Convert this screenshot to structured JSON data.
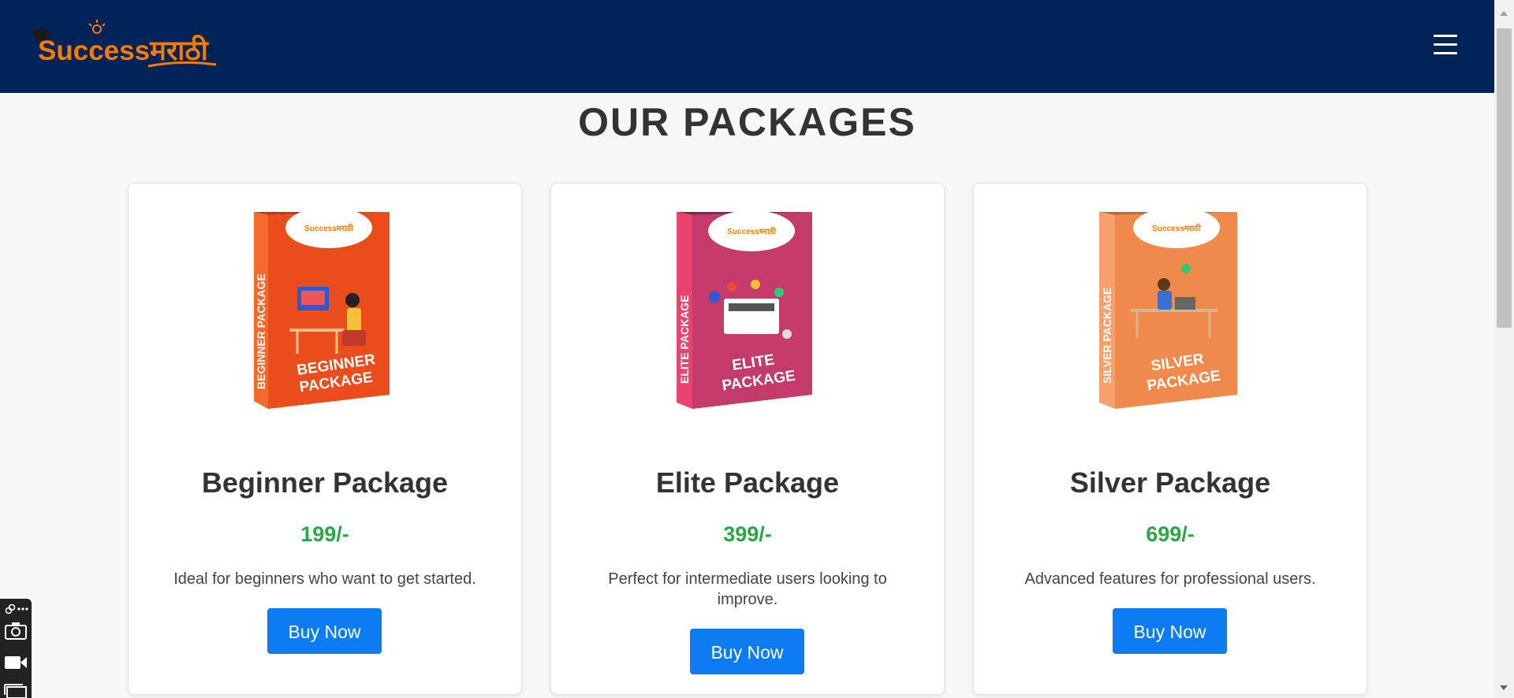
{
  "header": {
    "logo_text": "Successमराठी",
    "menu_icon": "hamburger-icon",
    "background_color": "#002458",
    "logo_color": "#f57c00"
  },
  "main": {
    "section_title": "OUR PACKAGES",
    "packages": [
      {
        "title": "Beginner Package",
        "price": "199/-",
        "description": "Ideal for beginners who want to get started.",
        "button_label": "Buy Now",
        "box_side_text": "BEGINNER PACKAGE",
        "box_front_text_line1": "BEGINNER",
        "box_front_text_line2": "PACKAGE",
        "box_brand_text": "Successमराठी",
        "box_color": "#ea4d1b"
      },
      {
        "title": "Elite Package",
        "price": "399/-",
        "description": "Perfect for intermediate users looking to improve.",
        "button_label": "Buy Now",
        "box_side_text": "ELITE PACKAGE",
        "box_front_text_line1": "ELITE",
        "box_front_text_line2": "PACKAGE",
        "box_brand_text": "Successमराठी",
        "box_color": "#c43a6a"
      },
      {
        "title": "Silver Package",
        "price": "699/-",
        "description": "Advanced features for professional users.",
        "button_label": "Buy Now",
        "box_side_text": "SILVER PACKAGE",
        "box_front_text_line1": "SILVER",
        "box_front_text_line2": "PACKAGE",
        "box_brand_text": "Successमराठी",
        "box_color": "#ef8a4c"
      }
    ],
    "price_color": "#28a745",
    "button_color": "#0d7bf2"
  },
  "floating_toolbar": {
    "icons": [
      "link-icon",
      "more-icon",
      "camera-icon",
      "video-icon",
      "window-icon"
    ]
  }
}
